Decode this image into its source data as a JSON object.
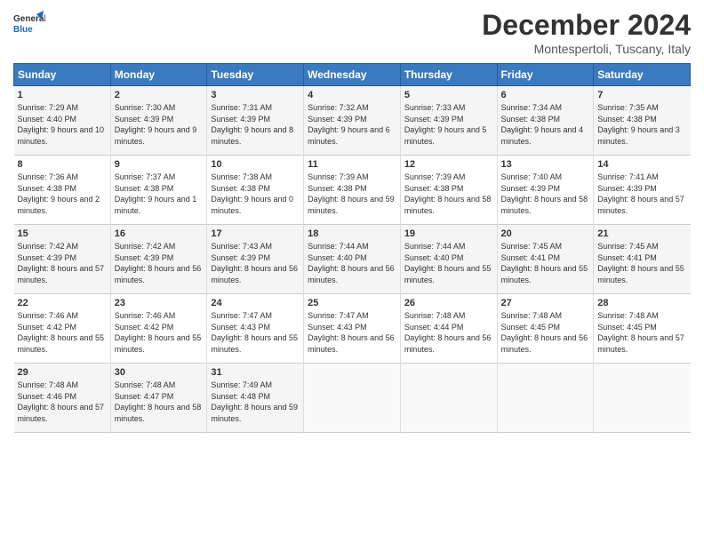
{
  "logo": {
    "line1": "General",
    "line2": "Blue"
  },
  "title": "December 2024",
  "subtitle": "Montespertoli, Tuscany, Italy",
  "days_header": [
    "Sunday",
    "Monday",
    "Tuesday",
    "Wednesday",
    "Thursday",
    "Friday",
    "Saturday"
  ],
  "weeks": [
    [
      {
        "day": "1",
        "sunrise": "Sunrise: 7:29 AM",
        "sunset": "Sunset: 4:40 PM",
        "daylight": "Daylight: 9 hours and 10 minutes."
      },
      {
        "day": "2",
        "sunrise": "Sunrise: 7:30 AM",
        "sunset": "Sunset: 4:39 PM",
        "daylight": "Daylight: 9 hours and 9 minutes."
      },
      {
        "day": "3",
        "sunrise": "Sunrise: 7:31 AM",
        "sunset": "Sunset: 4:39 PM",
        "daylight": "Daylight: 9 hours and 8 minutes."
      },
      {
        "day": "4",
        "sunrise": "Sunrise: 7:32 AM",
        "sunset": "Sunset: 4:39 PM",
        "daylight": "Daylight: 9 hours and 6 minutes."
      },
      {
        "day": "5",
        "sunrise": "Sunrise: 7:33 AM",
        "sunset": "Sunset: 4:39 PM",
        "daylight": "Daylight: 9 hours and 5 minutes."
      },
      {
        "day": "6",
        "sunrise": "Sunrise: 7:34 AM",
        "sunset": "Sunset: 4:38 PM",
        "daylight": "Daylight: 9 hours and 4 minutes."
      },
      {
        "day": "7",
        "sunrise": "Sunrise: 7:35 AM",
        "sunset": "Sunset: 4:38 PM",
        "daylight": "Daylight: 9 hours and 3 minutes."
      }
    ],
    [
      {
        "day": "8",
        "sunrise": "Sunrise: 7:36 AM",
        "sunset": "Sunset: 4:38 PM",
        "daylight": "Daylight: 9 hours and 2 minutes."
      },
      {
        "day": "9",
        "sunrise": "Sunrise: 7:37 AM",
        "sunset": "Sunset: 4:38 PM",
        "daylight": "Daylight: 9 hours and 1 minute."
      },
      {
        "day": "10",
        "sunrise": "Sunrise: 7:38 AM",
        "sunset": "Sunset: 4:38 PM",
        "daylight": "Daylight: 9 hours and 0 minutes."
      },
      {
        "day": "11",
        "sunrise": "Sunrise: 7:39 AM",
        "sunset": "Sunset: 4:38 PM",
        "daylight": "Daylight: 8 hours and 59 minutes."
      },
      {
        "day": "12",
        "sunrise": "Sunrise: 7:39 AM",
        "sunset": "Sunset: 4:38 PM",
        "daylight": "Daylight: 8 hours and 58 minutes."
      },
      {
        "day": "13",
        "sunrise": "Sunrise: 7:40 AM",
        "sunset": "Sunset: 4:39 PM",
        "daylight": "Daylight: 8 hours and 58 minutes."
      },
      {
        "day": "14",
        "sunrise": "Sunrise: 7:41 AM",
        "sunset": "Sunset: 4:39 PM",
        "daylight": "Daylight: 8 hours and 57 minutes."
      }
    ],
    [
      {
        "day": "15",
        "sunrise": "Sunrise: 7:42 AM",
        "sunset": "Sunset: 4:39 PM",
        "daylight": "Daylight: 8 hours and 57 minutes."
      },
      {
        "day": "16",
        "sunrise": "Sunrise: 7:42 AM",
        "sunset": "Sunset: 4:39 PM",
        "daylight": "Daylight: 8 hours and 56 minutes."
      },
      {
        "day": "17",
        "sunrise": "Sunrise: 7:43 AM",
        "sunset": "Sunset: 4:39 PM",
        "daylight": "Daylight: 8 hours and 56 minutes."
      },
      {
        "day": "18",
        "sunrise": "Sunrise: 7:44 AM",
        "sunset": "Sunset: 4:40 PM",
        "daylight": "Daylight: 8 hours and 56 minutes."
      },
      {
        "day": "19",
        "sunrise": "Sunrise: 7:44 AM",
        "sunset": "Sunset: 4:40 PM",
        "daylight": "Daylight: 8 hours and 55 minutes."
      },
      {
        "day": "20",
        "sunrise": "Sunrise: 7:45 AM",
        "sunset": "Sunset: 4:41 PM",
        "daylight": "Daylight: 8 hours and 55 minutes."
      },
      {
        "day": "21",
        "sunrise": "Sunrise: 7:45 AM",
        "sunset": "Sunset: 4:41 PM",
        "daylight": "Daylight: 8 hours and 55 minutes."
      }
    ],
    [
      {
        "day": "22",
        "sunrise": "Sunrise: 7:46 AM",
        "sunset": "Sunset: 4:42 PM",
        "daylight": "Daylight: 8 hours and 55 minutes."
      },
      {
        "day": "23",
        "sunrise": "Sunrise: 7:46 AM",
        "sunset": "Sunset: 4:42 PM",
        "daylight": "Daylight: 8 hours and 55 minutes."
      },
      {
        "day": "24",
        "sunrise": "Sunrise: 7:47 AM",
        "sunset": "Sunset: 4:43 PM",
        "daylight": "Daylight: 8 hours and 55 minutes."
      },
      {
        "day": "25",
        "sunrise": "Sunrise: 7:47 AM",
        "sunset": "Sunset: 4:43 PM",
        "daylight": "Daylight: 8 hours and 56 minutes."
      },
      {
        "day": "26",
        "sunrise": "Sunrise: 7:48 AM",
        "sunset": "Sunset: 4:44 PM",
        "daylight": "Daylight: 8 hours and 56 minutes."
      },
      {
        "day": "27",
        "sunrise": "Sunrise: 7:48 AM",
        "sunset": "Sunset: 4:45 PM",
        "daylight": "Daylight: 8 hours and 56 minutes."
      },
      {
        "day": "28",
        "sunrise": "Sunrise: 7:48 AM",
        "sunset": "Sunset: 4:45 PM",
        "daylight": "Daylight: 8 hours and 57 minutes."
      }
    ],
    [
      {
        "day": "29",
        "sunrise": "Sunrise: 7:48 AM",
        "sunset": "Sunset: 4:46 PM",
        "daylight": "Daylight: 8 hours and 57 minutes."
      },
      {
        "day": "30",
        "sunrise": "Sunrise: 7:48 AM",
        "sunset": "Sunset: 4:47 PM",
        "daylight": "Daylight: 8 hours and 58 minutes."
      },
      {
        "day": "31",
        "sunrise": "Sunrise: 7:49 AM",
        "sunset": "Sunset: 4:48 PM",
        "daylight": "Daylight: 8 hours and 59 minutes."
      },
      null,
      null,
      null,
      null
    ]
  ]
}
